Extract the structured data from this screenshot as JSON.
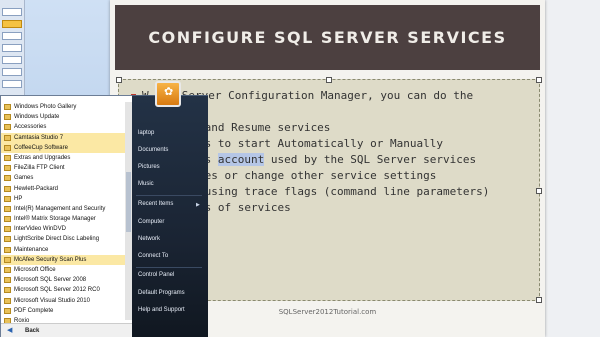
{
  "slide": {
    "title": "CONFIGURE SQL SERVER SERVICES",
    "bullets": [
      {
        "text": "W SQL Server Configuration Manager, you can do the",
        "level": 1
      },
      {
        "text": "",
        "level": 2
      },
      {
        "text": "p, Pause and Resume services",
        "level": 2
      },
      {
        "text": "e services to start Automatically or Manually",
        "level": 2
      },
      {
        "text": "he Windows ",
        "highlight": "account",
        "after": " used by the SQL Server services",
        "level": 2
      },
      {
        "text": "he services or change other service settings",
        "level": 2
      },
      {
        "text": "L Server using trace flags (command line parameters)",
        "level": 2
      },
      {
        "text": "properties of services",
        "level": 2
      }
    ],
    "footer": "SQLServer2012Tutorial.com"
  },
  "start_menu": {
    "programs": [
      {
        "label": "Windows Photo Gallery",
        "highlighted": false
      },
      {
        "label": "Windows Update",
        "highlighted": false
      },
      {
        "label": "Accessories",
        "highlighted": false
      },
      {
        "label": "Camtasia Studio 7",
        "highlighted": true
      },
      {
        "label": "CoffeeCup Software",
        "highlighted": true
      },
      {
        "label": "Extras and Upgrades",
        "highlighted": false
      },
      {
        "label": "FileZilla FTP Client",
        "highlighted": false
      },
      {
        "label": "Games",
        "highlighted": false
      },
      {
        "label": "Hewlett-Packard",
        "highlighted": false
      },
      {
        "label": "HP",
        "highlighted": false
      },
      {
        "label": "Intel(R) Management and Security",
        "highlighted": false
      },
      {
        "label": "Intel® Matrix Storage Manager",
        "highlighted": false
      },
      {
        "label": "InterVideo WinDVD",
        "highlighted": false
      },
      {
        "label": "LightScribe Direct Disc Labeling",
        "highlighted": false
      },
      {
        "label": "Maintenance",
        "highlighted": false
      },
      {
        "label": "McAfee Security Scan Plus",
        "highlighted": true
      },
      {
        "label": "Microsoft Office",
        "highlighted": false
      },
      {
        "label": "Microsoft SQL Server 2008",
        "highlighted": false
      },
      {
        "label": "Microsoft SQL Server 2012 RC0",
        "highlighted": false
      },
      {
        "label": "Microsoft Visual Studio 2010",
        "highlighted": false
      },
      {
        "label": "PDF Complete",
        "highlighted": false
      },
      {
        "label": "Roxio",
        "highlighted": false
      }
    ],
    "back_label": "Back",
    "back_arrow": "◀",
    "places": [
      {
        "label": "laptop",
        "arrow": false
      },
      {
        "label": "Documents",
        "arrow": false
      },
      {
        "label": "Pictures",
        "arrow": false
      },
      {
        "label": "Music",
        "arrow": false
      },
      {
        "label": "Recent Items",
        "arrow": true
      },
      {
        "label": "Computer",
        "arrow": false
      },
      {
        "label": "Network",
        "arrow": false
      },
      {
        "label": "Connect To",
        "arrow": false
      },
      {
        "label": "Control Panel",
        "arrow": false
      },
      {
        "label": "Default Programs",
        "arrow": false
      },
      {
        "label": "Help and Support",
        "arrow": false
      }
    ]
  }
}
